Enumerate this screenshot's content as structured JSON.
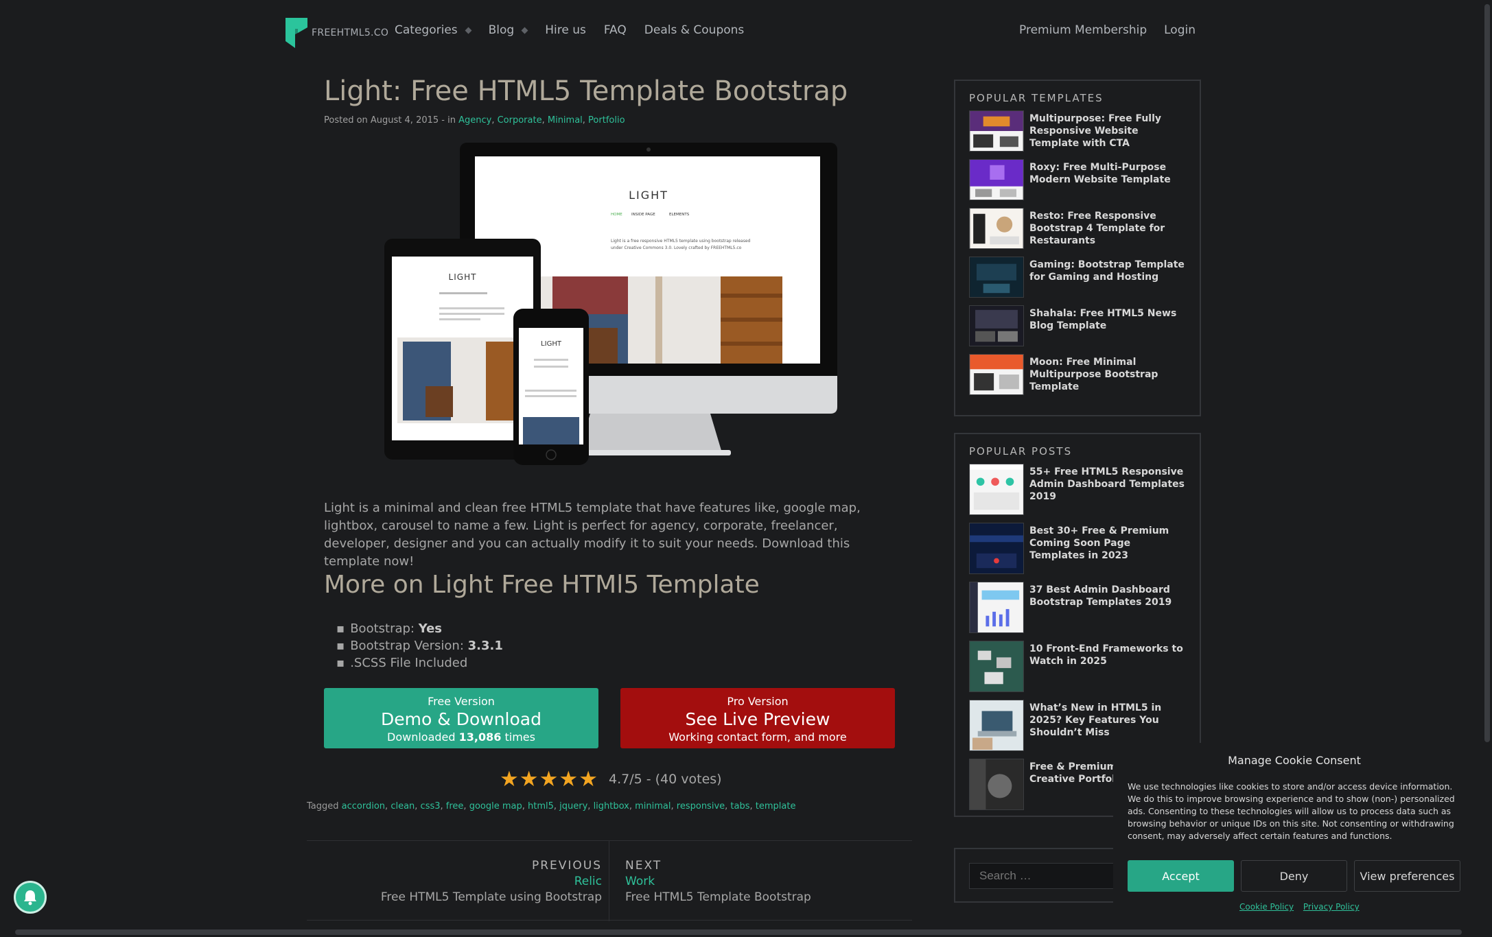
{
  "colors": {
    "accent": "#2fc19a",
    "free_button": "#27a686",
    "pro_button": "#a30e0e",
    "star": "#f3a521"
  },
  "header": {
    "logo_text": "FREEHTML5.CO",
    "nav": [
      "Categories",
      "Blog",
      "Hire us",
      "FAQ",
      "Deals & Coupons"
    ],
    "nav_right": [
      "Premium Membership",
      "Login"
    ]
  },
  "article": {
    "title": "Light: Free HTML5 Template Bootstrap",
    "meta_prefix": "Posted on August 4, 2015 - in ",
    "categories": [
      "Agency",
      "Corporate",
      "Minimal",
      "Portfolio"
    ],
    "hero": {
      "brand": "LIGHT",
      "menu": [
        "HOME",
        "INSIDE PAGE",
        "ELEMENTS"
      ],
      "blurb_1": "Light is a free responsive HTML5 template using bootstrap released",
      "blurb_2": "under Creative Commons 3.0. Lovely crafted by FREEHTML5.co"
    },
    "description": "Light is a minimal and clean free HTML5 template that have features like, google map, lightbox, carousel to name a few. Light is perfect for agency, corporate, freelancer, developer, designer and you can actually modify it to suit your needs. Download this template now!",
    "more_heading": "More on Light Free HTMl5 Template",
    "features": [
      {
        "label": "Bootstrap: ",
        "value": "Yes"
      },
      {
        "label": "Bootstrap Version: ",
        "value": "3.3.1"
      },
      {
        "label": ".SCSS File Included",
        "value": ""
      }
    ],
    "free_button": {
      "small": "Free Version",
      "big": "Demo & Download",
      "sub_prefix": "Downloaded ",
      "count": "13,086",
      "sub_suffix": " times"
    },
    "pro_button": {
      "small": "Pro Version",
      "big": "See Live Preview",
      "sub": "Working contact form, and more"
    },
    "rating": {
      "stars": 5,
      "text": "4.7/5 - (40 votes)"
    },
    "tags_label": "Tagged ",
    "tags": [
      "accordion",
      "clean",
      "css3",
      "free",
      "google map",
      "html5",
      "jquery",
      "lightbox",
      "minimal",
      "responsive",
      "tabs",
      "template"
    ],
    "prev": {
      "label": "PREVIOUS",
      "title": "Relic",
      "sub": "Free HTML5 Template using Bootstrap"
    },
    "next": {
      "label": "NEXT",
      "title": "Work",
      "sub": "Free HTML5 Template Bootstrap"
    }
  },
  "sidebar": {
    "popular_templates": {
      "title": "POPULAR TEMPLATES",
      "items": [
        "Multipurpose: Free Fully Responsive Website Template with CTA",
        "Roxy: Free Multi-Purpose Modern Website Template",
        "Resto: Free Responsive Bootstrap 4 Template for Restaurants",
        "Gaming: Bootstrap Template for Gaming and Hosting",
        "Shahala: Free HTML5 News Blog Template",
        "Moon: Free Minimal Multipurpose Bootstrap Template"
      ]
    },
    "popular_posts": {
      "title": "POPULAR POSTS",
      "items": [
        "55+ Free HTML5 Responsive Admin Dashboard Templates 2019",
        "Best 30+ Free & Premium Coming Soon Page Templates in 2023",
        "37 Best Admin Dashboard Bootstrap Templates 2019",
        "10 Front-End Frameworks to Watch in 2025",
        "What’s New in HTML5 in 2025? Key Features You Shouldn’t Miss",
        "Free & Premium Ph\nCreative Portfolio W"
      ]
    },
    "search_placeholder": "Search …"
  },
  "cookie": {
    "title": "Manage Cookie Consent",
    "body": "We use technologies like cookies to store and/or access device information. We do this to improve browsing experience and to show (non-) personalized ads. Consenting to these technologies will allow us to process data such as browsing behavior or unique IDs on this site. Not consenting or withdrawing consent, may adversely affect certain features and functions.",
    "accept": "Accept",
    "deny": "Deny",
    "prefs": "View preferences",
    "links": [
      "Cookie Policy",
      "Privacy Policy"
    ]
  }
}
